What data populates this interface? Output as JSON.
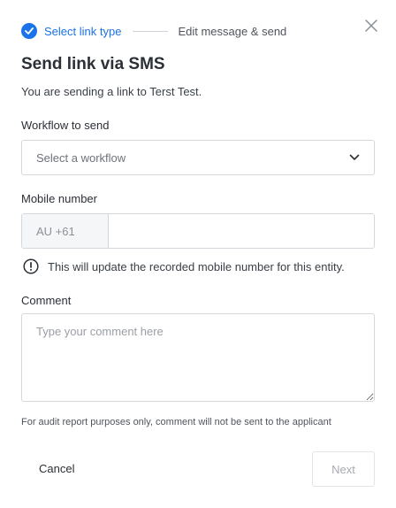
{
  "stepper": {
    "step1_label": "Select link type",
    "step2_label": "Edit message & send",
    "accent_color": "#1a73e8"
  },
  "title": "Send link via SMS",
  "subtitle": "You are sending a link to Terst Test.",
  "workflow": {
    "label": "Workflow to send",
    "placeholder": "Select a workflow"
  },
  "mobile": {
    "label": "Mobile number",
    "prefix": "AU +61",
    "value": "",
    "info": "This will update the recorded mobile number for this entity."
  },
  "comment": {
    "label": "Comment",
    "placeholder": "Type your comment here",
    "note": "For audit report purposes only, comment will not be sent to the applicant"
  },
  "actions": {
    "cancel": "Cancel",
    "next": "Next"
  },
  "icons": {
    "close": "close-icon",
    "check": "check-circle-icon",
    "chevron": "chevron-down-icon",
    "info": "exclamation-circle-icon"
  }
}
